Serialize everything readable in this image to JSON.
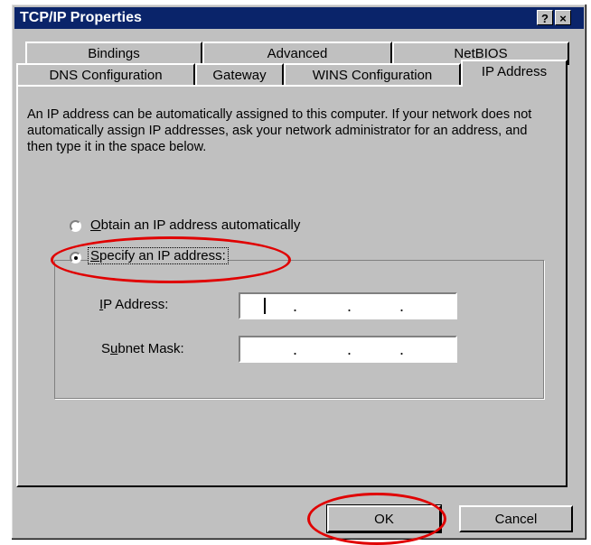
{
  "window": {
    "title": "TCP/IP Properties",
    "help_button": "?",
    "close_button": "×"
  },
  "tabs_back": [
    "Bindings",
    "Advanced",
    "NetBIOS"
  ],
  "tabs_front": [
    "DNS Configuration",
    "Gateway",
    "WINS Configuration",
    "IP Address"
  ],
  "active_tab": "IP Address",
  "description": "An IP address can be automatically assigned to this computer. If your network does not automatically assign IP addresses, ask your network administrator for an address, and then type it in the space below.",
  "radio_auto": {
    "mnemonic": "O",
    "rest": "btain an IP address automatically",
    "selected": false
  },
  "radio_specify": {
    "mnemonic": "S",
    "rest": "pecify an IP address:",
    "selected": true
  },
  "fields": {
    "ip_label_mn": "I",
    "ip_label_rest": "P Address:",
    "subnet_label_a": "S",
    "subnet_label_mn": "u",
    "subnet_label_rest": "bnet Mask:",
    "dot": "."
  },
  "buttons": {
    "ok": "OK",
    "cancel": "Cancel"
  },
  "annotation_color": "#e00000"
}
